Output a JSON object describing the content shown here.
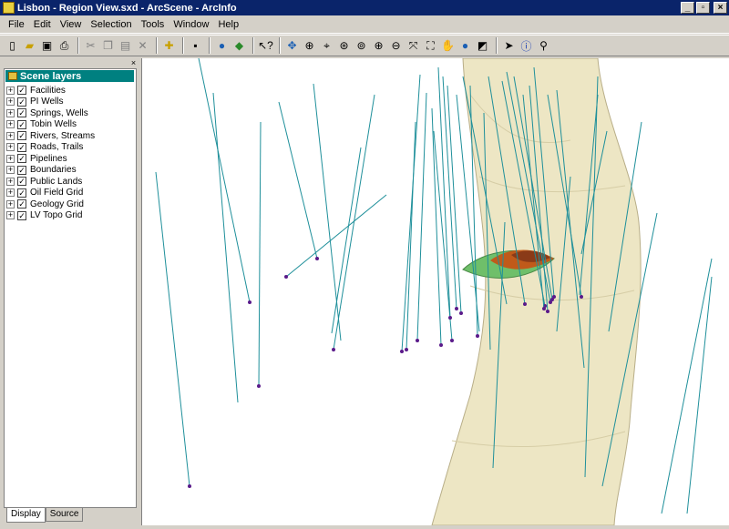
{
  "window": {
    "title": "Lisbon - Region View.sxd - ArcScene - ArcInfo"
  },
  "menu": [
    "File",
    "Edit",
    "View",
    "Selection",
    "Tools",
    "Window",
    "Help"
  ],
  "toolbar_icons": [
    "new-icon",
    "open-icon",
    "save-icon",
    "print-icon",
    "cut-icon",
    "copy-icon",
    "paste-icon",
    "delete-icon",
    "add-data-icon",
    "save-scene-icon",
    "globe-icon",
    "layers-icon",
    "whats-this-icon",
    "navigate-icon",
    "zoom-in-out-icon",
    "center-target-icon",
    "zoom-to-target-icon",
    "set-observer-icon",
    "zoom-in-icon",
    "zoom-out-icon",
    "full-extent-icon",
    "full-screen-icon",
    "pan-icon",
    "fly-icon",
    "identify-view-icon",
    "select-icon",
    "identify-icon",
    "find-icon"
  ],
  "toc": {
    "header": "Scene layers",
    "layers": [
      "Facilities",
      "PI Wells",
      "Springs, Wells",
      "Tobin Wells",
      "Rivers, Streams",
      "Roads, Trails",
      "Pipelines",
      "Boundaries",
      "Public Lands",
      "Oil Field Grid",
      "Geology Grid",
      "LV Topo Grid"
    ],
    "tabs": [
      "Display",
      "Source"
    ]
  },
  "colors": {
    "titlebar": "#0a246a",
    "toc_header": "#008080",
    "well_line": "#1e8f9a",
    "terrain": "#ede6c4"
  }
}
